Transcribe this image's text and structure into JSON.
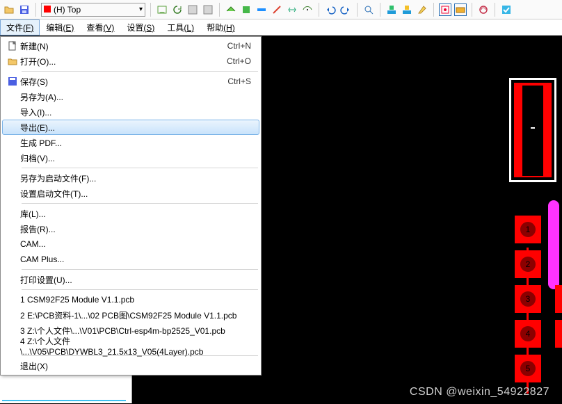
{
  "toolbar": {
    "layer_label": "(H) Top"
  },
  "menubar": {
    "file": {
      "label": "文件",
      "accel": "(F)"
    },
    "edit": {
      "label": "编辑",
      "accel": "(E)"
    },
    "view": {
      "label": "查看",
      "accel": "(V)"
    },
    "setup": {
      "label": "设置",
      "accel": "(S)"
    },
    "tools": {
      "label": "工具",
      "accel": "(L)"
    },
    "help": {
      "label": "帮助",
      "accel": "(H)"
    }
  },
  "file_menu": {
    "new": {
      "label": "新建(N)",
      "shortcut": "Ctrl+N"
    },
    "open": {
      "label": "打开(O)...",
      "shortcut": "Ctrl+O"
    },
    "save": {
      "label": "保存(S)",
      "shortcut": "Ctrl+S"
    },
    "save_as": {
      "label": "另存为(A)..."
    },
    "import": {
      "label": "导入(I)..."
    },
    "export": {
      "label": "导出(E)..."
    },
    "gen_pdf": {
      "label": "生成 PDF..."
    },
    "archive": {
      "label": "归档(V)..."
    },
    "save_start": {
      "label": "另存为启动文件(F)..."
    },
    "set_start": {
      "label": "设置启动文件(T)..."
    },
    "library": {
      "label": "库(L)..."
    },
    "report": {
      "label": "报告(R)..."
    },
    "cam": {
      "label": "CAM..."
    },
    "cam_plus": {
      "label": "CAM Plus..."
    },
    "print": {
      "label": "打印设置(U)..."
    },
    "recent1": {
      "label": "1 CSM92F25 Module V1.1.pcb"
    },
    "recent2": {
      "label": "2 E:\\PCB资料-1\\...\\02 PCB图\\CSM92F25 Module V1.1.pcb"
    },
    "recent3": {
      "label": "3 Z:\\个人文件\\...\\V01\\PCB\\Ctrl-esp4m-bp2525_V01.pcb"
    },
    "recent4": {
      "label": "4 Z:\\个人文件\\...\\V05\\PCB\\DYWBL3_21.5x13_V05(4Layer).pcb"
    },
    "exit": {
      "label": "退出(X)"
    }
  },
  "pads": {
    "p1": "1",
    "p2": "2",
    "p3": "3",
    "p4": "4",
    "p5": "5"
  },
  "watermark": "CSDN @weixin_54922827"
}
